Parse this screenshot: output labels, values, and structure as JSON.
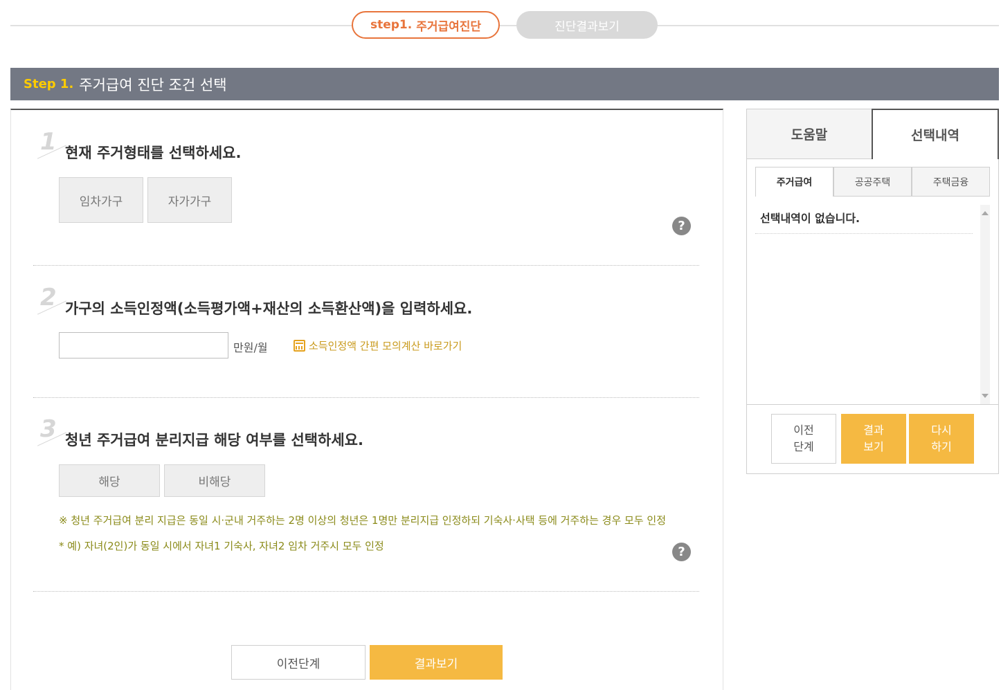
{
  "stepbar": {
    "step1_num": "step1.",
    "step1_label": "주거급여진단",
    "step2_label": "진단결과보기"
  },
  "header": {
    "step_label": "Step 1.",
    "title": "주거급여 진단 조건 선택"
  },
  "questions": [
    {
      "num": "1",
      "title": "현재 주거형태를 선택하세요.",
      "options": [
        "임차가구",
        "자가가구"
      ]
    },
    {
      "num": "2",
      "title": "가구의 소득인정액(소득평가액+재산의 소득환산액)을 입력하세요.",
      "input_value": "",
      "unit": "만원/월",
      "calc_link": "소득인정액 간편 모의계산 바로가기"
    },
    {
      "num": "3",
      "title": "청년 주거급여 분리지급 해당 여부를 선택하세요.",
      "options": [
        "해당",
        "비해당"
      ],
      "note1": "※ 청년 주거급여 분리 지급은 동일 시·군내 거주하는 2명 이상의 청년은 1명만 분리지급 인정하되 기숙사·사택 등에 거주하는 경우 모두 인정",
      "note2": "* 예) 자녀(2인)가 동일 시에서 자녀1 기숙사, 자녀2 임차 거주시 모두 인정"
    }
  ],
  "help_symbol": "?",
  "bottom_buttons": {
    "prev": "이전단계",
    "result": "결과보기"
  },
  "side": {
    "tabs": [
      "도움말",
      "선택내역"
    ],
    "active_tab": "선택내역",
    "sub_tabs": [
      "주거급여",
      "공공주택",
      "주택금융"
    ],
    "active_sub_tab": "주거급여",
    "empty_message": "선택내역이 없습니다.",
    "buttons": {
      "prev": "이전\n단계",
      "result": "결과\n보기",
      "retry": "다시\n하기"
    }
  },
  "colors": {
    "accent_orange": "#e8743b",
    "button_yellow": "#f5b942",
    "header_gray": "#737884",
    "step_label_yellow": "#ffcc00",
    "note_olive": "#8a8a18"
  }
}
